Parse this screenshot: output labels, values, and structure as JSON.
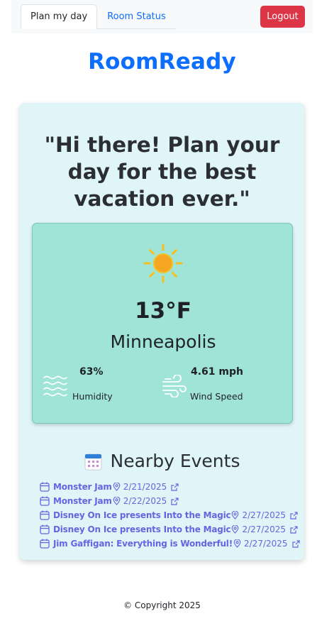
{
  "nav": {
    "tabs": [
      {
        "label": "Plan my day",
        "active": true
      },
      {
        "label": "Room Status",
        "active": false
      }
    ],
    "logout_label": "Logout"
  },
  "brand": "RoomReady",
  "quote": "\"Hi there! Plan your day for the best vacation ever.\"",
  "weather": {
    "icon": "sun-icon",
    "temperature": "13°F",
    "city": "Minneapolis",
    "humidity": {
      "value": "63%",
      "label": "Humidity",
      "icon": "water-waves-icon"
    },
    "wind": {
      "value": "4.61 mph",
      "label": "Wind Speed",
      "icon": "wind-icon"
    }
  },
  "events": {
    "title": "Nearby Events",
    "icon": "calendar-icon",
    "items": [
      {
        "name": "Monster Jam",
        "date": "2/21/2025"
      },
      {
        "name": "Monster Jam",
        "date": "2/22/2025"
      },
      {
        "name": "Disney On Ice presents Into the Magic",
        "date": "2/27/2025"
      },
      {
        "name": "Disney On Ice presents Into the Magic",
        "date": "2/27/2025"
      },
      {
        "name": "Jim Gaffigan: Everything is Wonderful!",
        "date": "2/27/2025"
      }
    ]
  },
  "footer": "© Copyright 2025",
  "colors": {
    "brand": "#0d6efd",
    "logout": "#dc3545",
    "card_bg": "#dff5f8",
    "weather_bg": "#a0e4d7",
    "event_link": "#6366e0"
  }
}
